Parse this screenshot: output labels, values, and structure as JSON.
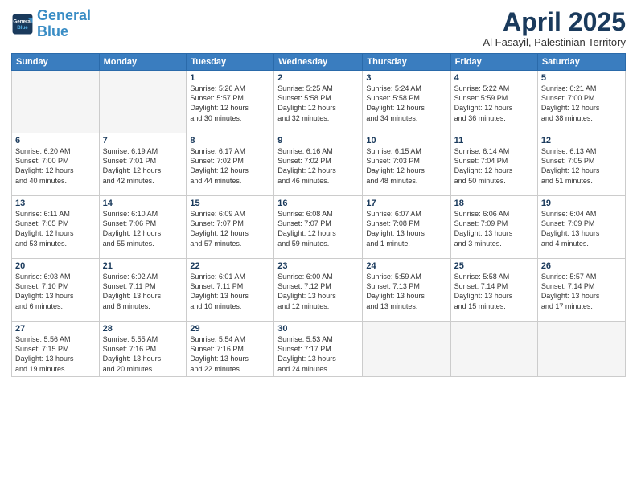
{
  "logo": {
    "line1": "General",
    "line2": "Blue"
  },
  "title": {
    "month_year": "April 2025",
    "location": "Al Fasayil, Palestinian Territory"
  },
  "weekdays": [
    "Sunday",
    "Monday",
    "Tuesday",
    "Wednesday",
    "Thursday",
    "Friday",
    "Saturday"
  ],
  "weeks": [
    [
      {
        "num": "",
        "detail": ""
      },
      {
        "num": "",
        "detail": ""
      },
      {
        "num": "1",
        "detail": "Sunrise: 5:26 AM\nSunset: 5:57 PM\nDaylight: 12 hours\nand 30 minutes."
      },
      {
        "num": "2",
        "detail": "Sunrise: 5:25 AM\nSunset: 5:58 PM\nDaylight: 12 hours\nand 32 minutes."
      },
      {
        "num": "3",
        "detail": "Sunrise: 5:24 AM\nSunset: 5:58 PM\nDaylight: 12 hours\nand 34 minutes."
      },
      {
        "num": "4",
        "detail": "Sunrise: 5:22 AM\nSunset: 5:59 PM\nDaylight: 12 hours\nand 36 minutes."
      },
      {
        "num": "5",
        "detail": "Sunrise: 6:21 AM\nSunset: 7:00 PM\nDaylight: 12 hours\nand 38 minutes."
      }
    ],
    [
      {
        "num": "6",
        "detail": "Sunrise: 6:20 AM\nSunset: 7:00 PM\nDaylight: 12 hours\nand 40 minutes."
      },
      {
        "num": "7",
        "detail": "Sunrise: 6:19 AM\nSunset: 7:01 PM\nDaylight: 12 hours\nand 42 minutes."
      },
      {
        "num": "8",
        "detail": "Sunrise: 6:17 AM\nSunset: 7:02 PM\nDaylight: 12 hours\nand 44 minutes."
      },
      {
        "num": "9",
        "detail": "Sunrise: 6:16 AM\nSunset: 7:02 PM\nDaylight: 12 hours\nand 46 minutes."
      },
      {
        "num": "10",
        "detail": "Sunrise: 6:15 AM\nSunset: 7:03 PM\nDaylight: 12 hours\nand 48 minutes."
      },
      {
        "num": "11",
        "detail": "Sunrise: 6:14 AM\nSunset: 7:04 PM\nDaylight: 12 hours\nand 50 minutes."
      },
      {
        "num": "12",
        "detail": "Sunrise: 6:13 AM\nSunset: 7:05 PM\nDaylight: 12 hours\nand 51 minutes."
      }
    ],
    [
      {
        "num": "13",
        "detail": "Sunrise: 6:11 AM\nSunset: 7:05 PM\nDaylight: 12 hours\nand 53 minutes."
      },
      {
        "num": "14",
        "detail": "Sunrise: 6:10 AM\nSunset: 7:06 PM\nDaylight: 12 hours\nand 55 minutes."
      },
      {
        "num": "15",
        "detail": "Sunrise: 6:09 AM\nSunset: 7:07 PM\nDaylight: 12 hours\nand 57 minutes."
      },
      {
        "num": "16",
        "detail": "Sunrise: 6:08 AM\nSunset: 7:07 PM\nDaylight: 12 hours\nand 59 minutes."
      },
      {
        "num": "17",
        "detail": "Sunrise: 6:07 AM\nSunset: 7:08 PM\nDaylight: 13 hours\nand 1 minute."
      },
      {
        "num": "18",
        "detail": "Sunrise: 6:06 AM\nSunset: 7:09 PM\nDaylight: 13 hours\nand 3 minutes."
      },
      {
        "num": "19",
        "detail": "Sunrise: 6:04 AM\nSunset: 7:09 PM\nDaylight: 13 hours\nand 4 minutes."
      }
    ],
    [
      {
        "num": "20",
        "detail": "Sunrise: 6:03 AM\nSunset: 7:10 PM\nDaylight: 13 hours\nand 6 minutes."
      },
      {
        "num": "21",
        "detail": "Sunrise: 6:02 AM\nSunset: 7:11 PM\nDaylight: 13 hours\nand 8 minutes."
      },
      {
        "num": "22",
        "detail": "Sunrise: 6:01 AM\nSunset: 7:11 PM\nDaylight: 13 hours\nand 10 minutes."
      },
      {
        "num": "23",
        "detail": "Sunrise: 6:00 AM\nSunset: 7:12 PM\nDaylight: 13 hours\nand 12 minutes."
      },
      {
        "num": "24",
        "detail": "Sunrise: 5:59 AM\nSunset: 7:13 PM\nDaylight: 13 hours\nand 13 minutes."
      },
      {
        "num": "25",
        "detail": "Sunrise: 5:58 AM\nSunset: 7:14 PM\nDaylight: 13 hours\nand 15 minutes."
      },
      {
        "num": "26",
        "detail": "Sunrise: 5:57 AM\nSunset: 7:14 PM\nDaylight: 13 hours\nand 17 minutes."
      }
    ],
    [
      {
        "num": "27",
        "detail": "Sunrise: 5:56 AM\nSunset: 7:15 PM\nDaylight: 13 hours\nand 19 minutes."
      },
      {
        "num": "28",
        "detail": "Sunrise: 5:55 AM\nSunset: 7:16 PM\nDaylight: 13 hours\nand 20 minutes."
      },
      {
        "num": "29",
        "detail": "Sunrise: 5:54 AM\nSunset: 7:16 PM\nDaylight: 13 hours\nand 22 minutes."
      },
      {
        "num": "30",
        "detail": "Sunrise: 5:53 AM\nSunset: 7:17 PM\nDaylight: 13 hours\nand 24 minutes."
      },
      {
        "num": "",
        "detail": ""
      },
      {
        "num": "",
        "detail": ""
      },
      {
        "num": "",
        "detail": ""
      }
    ]
  ]
}
